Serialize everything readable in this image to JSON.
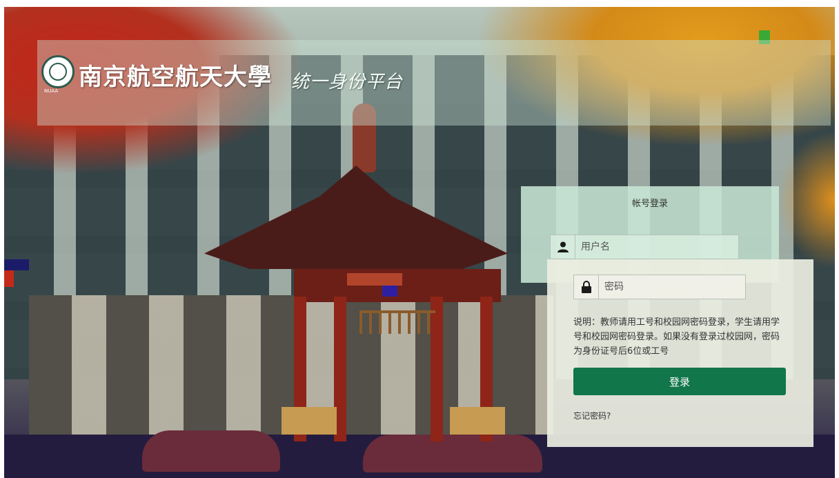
{
  "header": {
    "university_name": "南京航空航天大學",
    "university_abbr": "NUAA",
    "platform_title": "统一身份平台"
  },
  "login": {
    "title": "帐号登录",
    "username_placeholder": "用户名",
    "password_placeholder": "密码",
    "note": "说明：教师请用工号和校园网密码登录，学生请用学号和校园网密码登录。如果没有登录过校园网，密码为身份证号后6位或工号",
    "submit_label": "登录",
    "forgot_label": "忘记密码?"
  },
  "icons": {
    "logo": "university-seal-icon",
    "user": "user-icon",
    "lock": "lock-icon"
  },
  "colors": {
    "primary_button": "#11764a",
    "panel_tint": "#cae8d6",
    "panel_lower": "#eceee2"
  }
}
